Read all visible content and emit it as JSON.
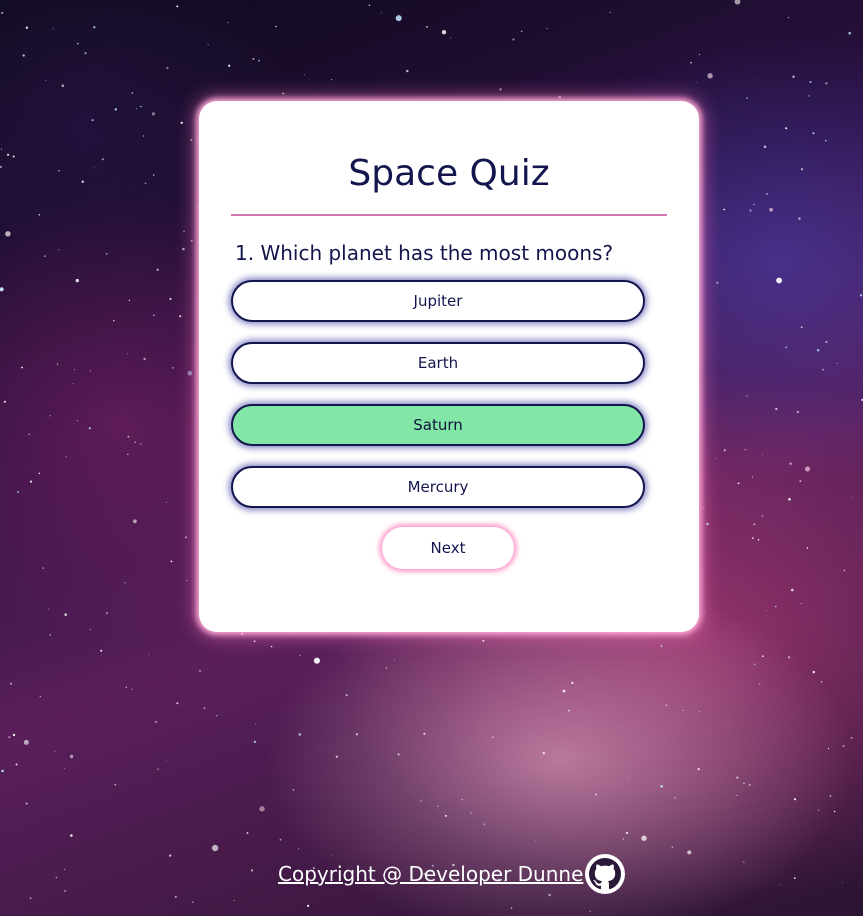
{
  "quiz": {
    "title": "Space Quiz",
    "question": "1. Which planet has the most moons?",
    "answers": [
      {
        "label": "Jupiter",
        "selected": false
      },
      {
        "label": "Earth",
        "selected": false
      },
      {
        "label": "Saturn",
        "selected": true
      },
      {
        "label": "Mercury",
        "selected": false
      }
    ],
    "next_label": "Next"
  },
  "footer": {
    "copyright": "Copyright @ Developer Dunne",
    "icon": "github-icon"
  },
  "colors": {
    "text": "#13164d",
    "selected_answer": "#82e6a7",
    "divider": "#d579b0",
    "card_glow": "#ffaad7"
  }
}
